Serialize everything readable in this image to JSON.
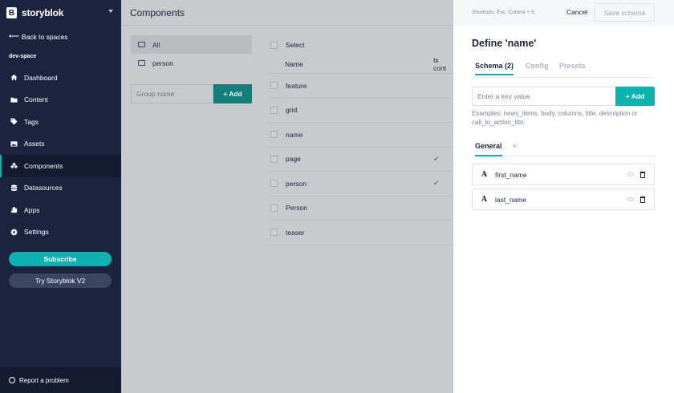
{
  "sidebar": {
    "brand_letter": "B",
    "brand_name": "storyblok",
    "back_label": "Back to spaces",
    "space_name": "dev-space",
    "items": [
      {
        "label": "Dashboard",
        "icon": "home-icon"
      },
      {
        "label": "Content",
        "icon": "folder-icon"
      },
      {
        "label": "Tags",
        "icon": "tag-icon"
      },
      {
        "label": "Assets",
        "icon": "image-icon"
      },
      {
        "label": "Components",
        "icon": "components-icon",
        "active": true
      },
      {
        "label": "Datasources",
        "icon": "database-icon"
      },
      {
        "label": "Apps",
        "icon": "puzzle-icon"
      },
      {
        "label": "Settings",
        "icon": "gear-icon"
      }
    ],
    "subscribe_label": "Subscribe",
    "try_label": "Try Storyblok V2",
    "report_label": "Report a problem"
  },
  "main": {
    "title": "Components",
    "groups": [
      {
        "label": "All"
      },
      {
        "label": "person"
      }
    ],
    "group_placeholder": "Group name",
    "group_add_label": "+ Add",
    "select_label": "Select",
    "col_name": "Name",
    "col_is_content": "Is cont",
    "rows": [
      {
        "name": "feature",
        "check": ""
      },
      {
        "name": "grid",
        "check": ""
      },
      {
        "name": "name",
        "check": ""
      },
      {
        "name": "page",
        "check": "✔"
      },
      {
        "name": "person",
        "check": "✔"
      },
      {
        "name": "Person",
        "check": ""
      },
      {
        "name": "teaser",
        "check": ""
      }
    ]
  },
  "drawer": {
    "shortcuts": "Shortcuts: Esc, Control + S",
    "cancel_label": "Cancel",
    "save_label": "Save schema",
    "title": "Define 'name'",
    "tabs": [
      {
        "label": "Schema (2)"
      },
      {
        "label": "Config"
      },
      {
        "label": "Presets"
      }
    ],
    "key_placeholder": "Enter a key value",
    "key_add_label": "+ Add",
    "examples": "Examples: news_items, body, columns, title, description or call_to_action_btn.",
    "subtab": "General",
    "subtab_add": "+",
    "fields": [
      {
        "type": "A",
        "name": "first_name"
      },
      {
        "type": "A",
        "name": "last_name"
      }
    ]
  },
  "colors": {
    "sidebar_bg": "#1b243f",
    "accent": "#09b3af",
    "overlay": "#c9cacd"
  }
}
